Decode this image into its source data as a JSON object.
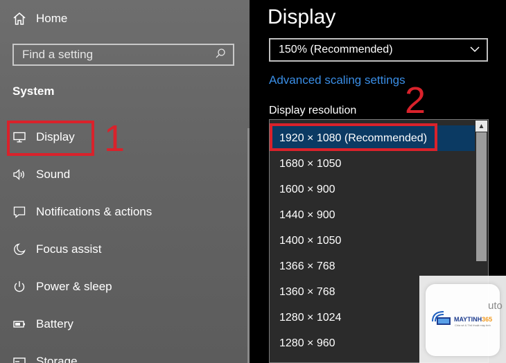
{
  "sidebar": {
    "home_label": "Home",
    "search_placeholder": "Find a setting",
    "section_title": "System",
    "items": [
      {
        "label": "Display",
        "icon": "monitor-icon"
      },
      {
        "label": "Sound",
        "icon": "speaker-icon"
      },
      {
        "label": "Notifications & actions",
        "icon": "notification-icon"
      },
      {
        "label": "Focus assist",
        "icon": "moon-icon"
      },
      {
        "label": "Power & sleep",
        "icon": "power-icon"
      },
      {
        "label": "Battery",
        "icon": "battery-icon"
      },
      {
        "label": "Storage",
        "icon": "storage-icon"
      }
    ]
  },
  "main": {
    "title": "Display",
    "scale_value": "150% (Recommended)",
    "advanced_link": "Advanced scaling settings",
    "resolution_label": "Display resolution",
    "resolution_options": [
      "1920 × 1080 (Recommended)",
      "1680 × 1050",
      "1600 × 900",
      "1440 × 900",
      "1400 × 1050",
      "1366 × 768",
      "1360 × 768",
      "1280 × 1024",
      "1280 × 960"
    ],
    "selected_resolution": "1920 × 1080 (Recommended)"
  },
  "annotations": {
    "step1": "1",
    "step2": "2"
  },
  "watermark": {
    "brand_a": "MAYTINH",
    "brand_b": "365",
    "tagline": "Chia sẻ & Thủ thuật máy tính",
    "ghost_text": "uto"
  },
  "colors": {
    "accent_link": "#3a8ee6",
    "annotation_red": "#d9222b",
    "selected_bg": "#0b3a63"
  }
}
